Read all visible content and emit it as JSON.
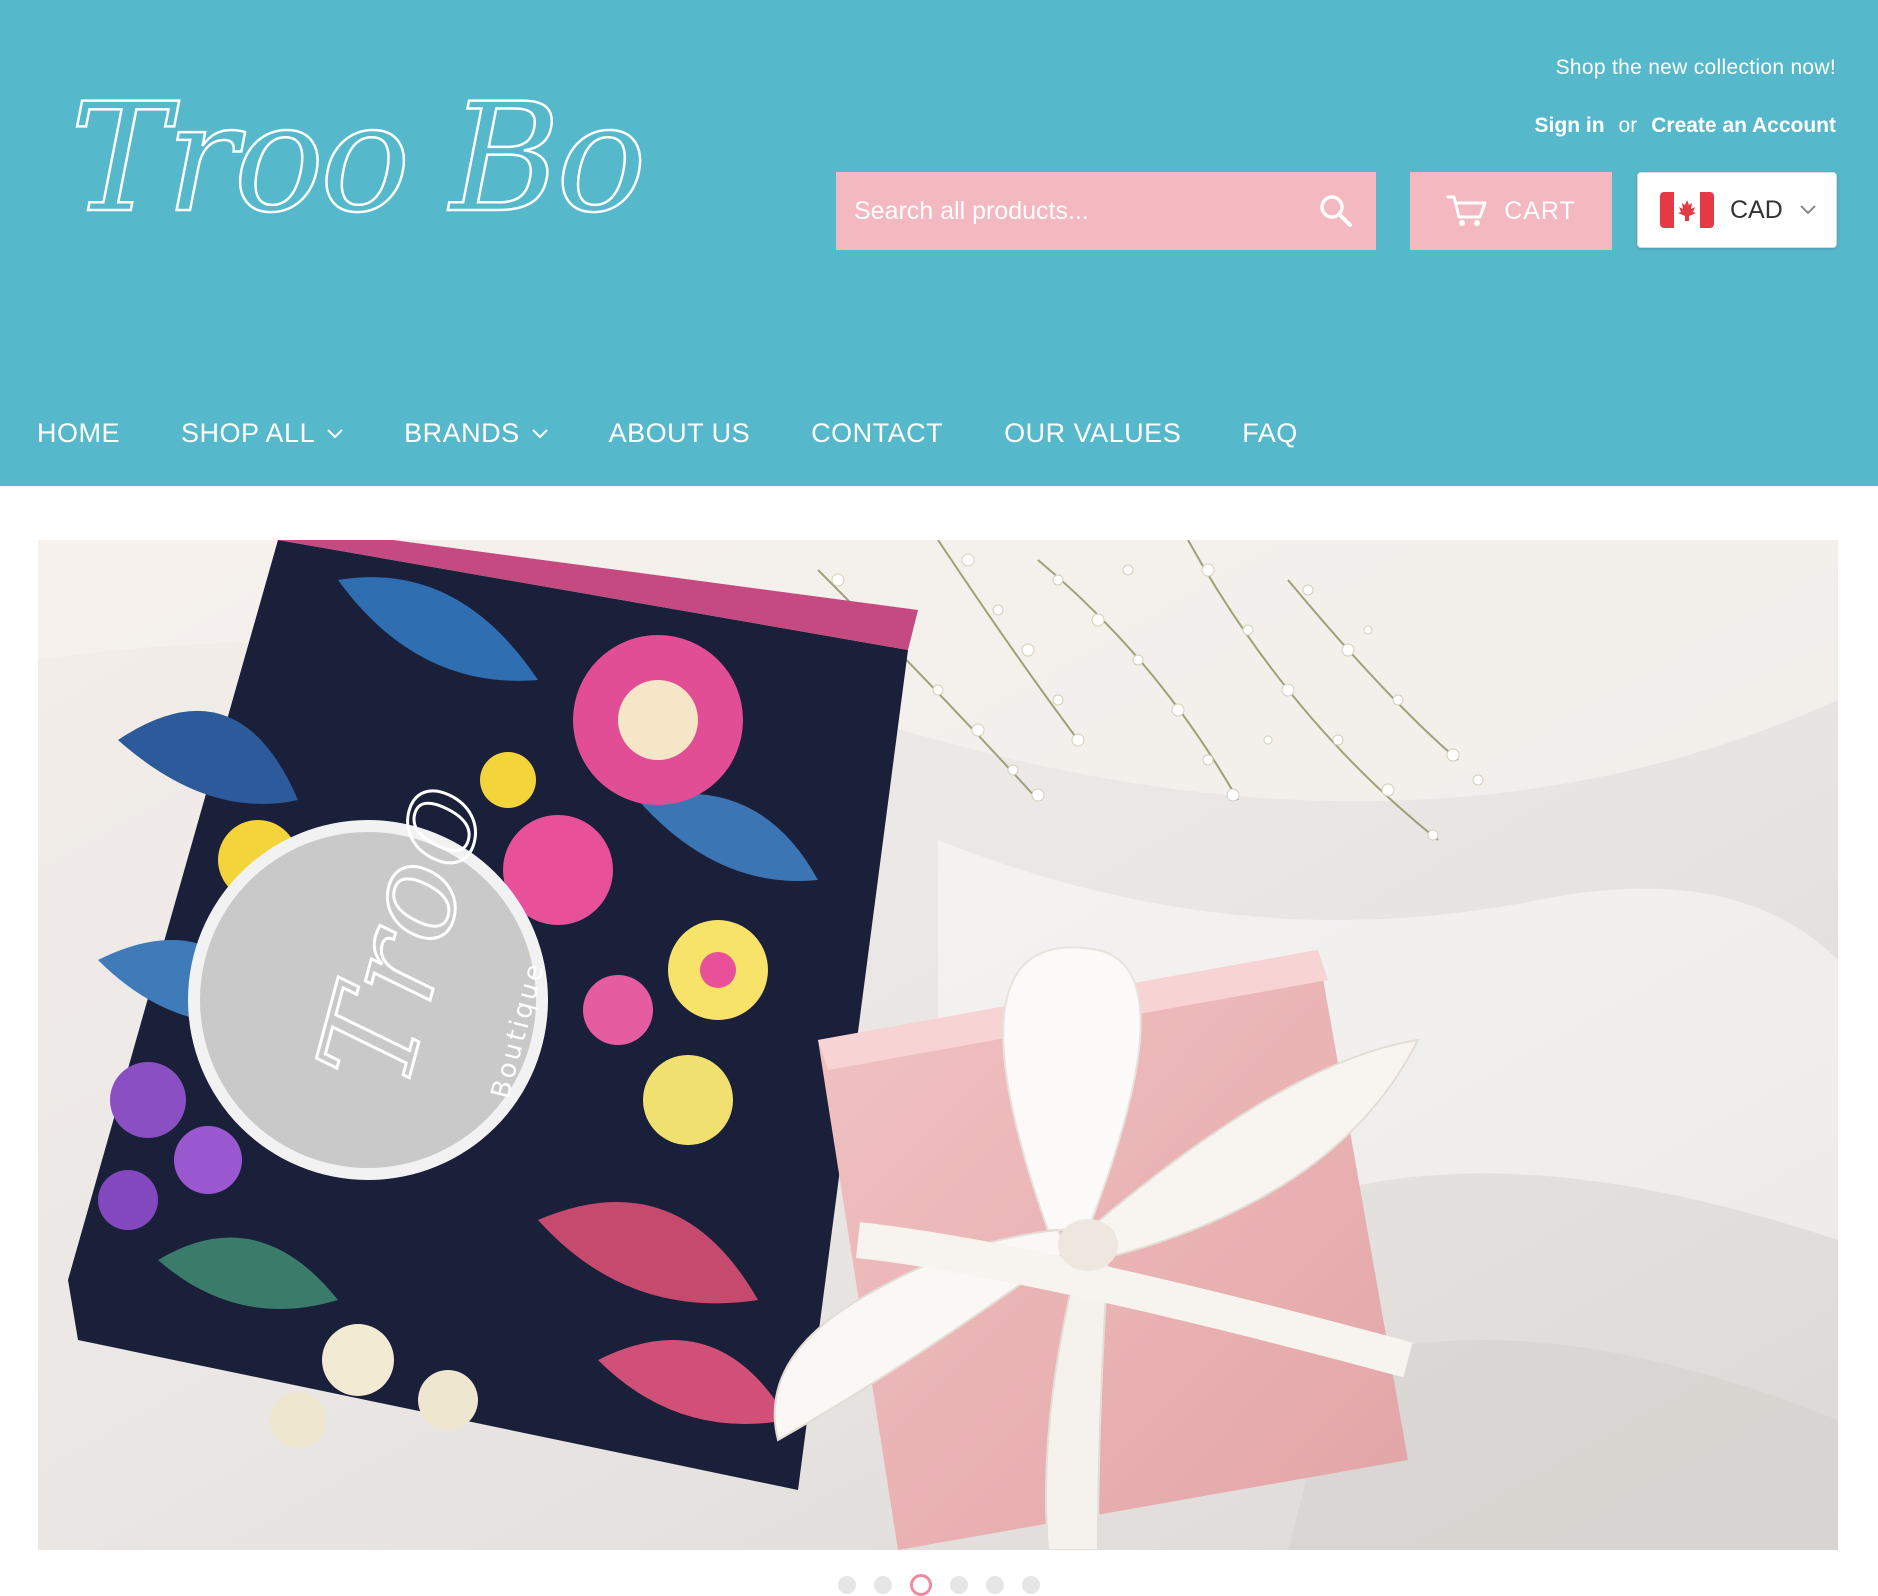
{
  "brand": {
    "logo_text": "Troo Boutique"
  },
  "header": {
    "tagline": "Shop the new collection now!",
    "sign_in": "Sign in",
    "or": "or",
    "create_account": "Create an Account"
  },
  "search": {
    "placeholder": "Search all products..."
  },
  "cart": {
    "label": "CART"
  },
  "currency": {
    "code": "CAD",
    "flag": "canada-flag-icon"
  },
  "nav": {
    "items": [
      {
        "label": "HOME"
      },
      {
        "label": "SHOP ALL"
      },
      {
        "label": "BRANDS"
      },
      {
        "label": "ABOUT US"
      },
      {
        "label": "CONTACT"
      },
      {
        "label": "OUR VALUES"
      },
      {
        "label": "FAQ"
      }
    ]
  },
  "hero": {
    "seal_script": "Troo",
    "seal_sub": "Boutique"
  },
  "slider": {
    "count": 6,
    "active_index": 3
  },
  "colors": {
    "header_bg": "#56b8cb",
    "pink": "#f3b8c0",
    "dot_active": "#f08aa0"
  }
}
